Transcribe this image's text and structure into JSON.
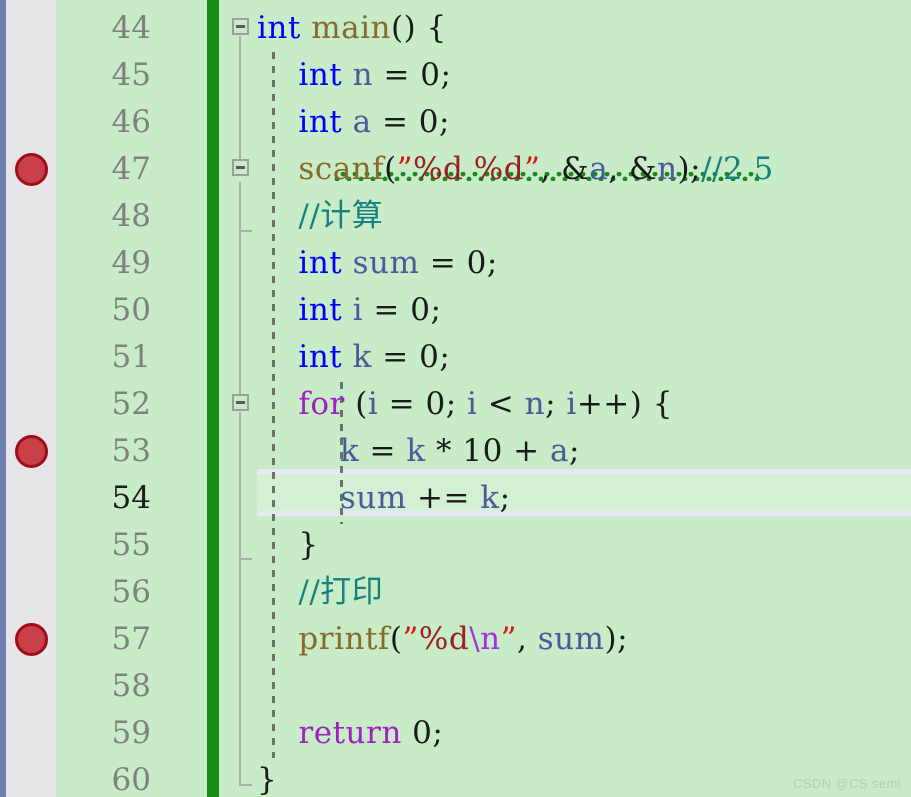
{
  "editor": {
    "language": "c",
    "background_color": "#c8ecc8",
    "gutter_color": "#e6e6e8",
    "change_bar_color": "#188a18",
    "edge_strip_color": "#6b7fae",
    "current_line": 54,
    "first_visible_line": 44,
    "last_visible_line": 60,
    "line_height": 47
  },
  "watermark": {
    "text": "CSDN @CS semi"
  },
  "breakpoints": [
    {
      "line": 47,
      "color": "#c8404a",
      "border_color": "#a00c18"
    },
    {
      "line": 53,
      "color": "#c8404a",
      "border_color": "#a00c18"
    },
    {
      "line": 57,
      "color": "#c8404a",
      "border_color": "#a00c18"
    }
  ],
  "line_numbers": [
    {
      "number": "44",
      "current": false
    },
    {
      "number": "45",
      "current": false
    },
    {
      "number": "46",
      "current": false
    },
    {
      "number": "47",
      "current": false
    },
    {
      "number": "48",
      "current": false
    },
    {
      "number": "49",
      "current": false
    },
    {
      "number": "50",
      "current": false
    },
    {
      "number": "51",
      "current": false
    },
    {
      "number": "52",
      "current": false
    },
    {
      "number": "53",
      "current": false
    },
    {
      "number": "54",
      "current": true
    },
    {
      "number": "55",
      "current": false
    },
    {
      "number": "56",
      "current": false
    },
    {
      "number": "57",
      "current": false
    },
    {
      "number": "58",
      "current": false
    },
    {
      "number": "59",
      "current": false
    },
    {
      "number": "60",
      "current": false
    }
  ],
  "fold_markers": [
    {
      "line": 44,
      "state": "expanded",
      "icon": "fold-minus-icon"
    },
    {
      "line": 47,
      "state": "expanded",
      "icon": "fold-minus-icon"
    },
    {
      "line": 52,
      "state": "expanded",
      "icon": "fold-minus-icon"
    }
  ],
  "code_lines": [
    {
      "line": 44,
      "text": "int main() {",
      "tokens": [
        {
          "t": "int",
          "c": "t-kw"
        },
        {
          "t": " ",
          "c": "t-plain"
        },
        {
          "t": "main",
          "c": "t-fn"
        },
        {
          "t": "() {",
          "c": "t-punct"
        }
      ]
    },
    {
      "line": 45,
      "text": "    int n = 0;",
      "tokens": [
        {
          "t": "    ",
          "c": "t-plain"
        },
        {
          "t": "int",
          "c": "t-kw"
        },
        {
          "t": " ",
          "c": "t-plain"
        },
        {
          "t": "n",
          "c": "t-var"
        },
        {
          "t": " = ",
          "c": "t-punct"
        },
        {
          "t": "0",
          "c": "t-num"
        },
        {
          "t": ";",
          "c": "t-punct"
        }
      ]
    },
    {
      "line": 46,
      "text": "    int a = 0;",
      "tokens": [
        {
          "t": "    ",
          "c": "t-plain"
        },
        {
          "t": "int",
          "c": "t-kw"
        },
        {
          "t": " ",
          "c": "t-plain"
        },
        {
          "t": "a",
          "c": "t-var"
        },
        {
          "t": " = ",
          "c": "t-punct"
        },
        {
          "t": "0",
          "c": "t-num"
        },
        {
          "t": ";",
          "c": "t-punct"
        }
      ]
    },
    {
      "line": 47,
      "text": "    scanf(\"%d %d\", &a, &n);//2 5",
      "has_error_squiggle": true,
      "tokens": [
        {
          "t": "    ",
          "c": "t-plain"
        },
        {
          "t": "scanf",
          "c": "t-fn"
        },
        {
          "t": "(",
          "c": "t-punct"
        },
        {
          "t": "”",
          "c": "t-quote"
        },
        {
          "t": "%d %d",
          "c": "t-str"
        },
        {
          "t": "”",
          "c": "t-quote"
        },
        {
          "t": ", ",
          "c": "t-punct"
        },
        {
          "t": "&",
          "c": "t-punct"
        },
        {
          "t": "a",
          "c": "t-var"
        },
        {
          "t": ", ",
          "c": "t-punct"
        },
        {
          "t": "&",
          "c": "t-punct"
        },
        {
          "t": "n",
          "c": "t-var"
        },
        {
          "t": ")",
          "c": "t-punct"
        },
        {
          "t": ";",
          "c": "t-punct"
        },
        {
          "t": "//2 5",
          "c": "t-comment"
        }
      ]
    },
    {
      "line": 48,
      "text": "    //计算",
      "tokens": [
        {
          "t": "    ",
          "c": "t-plain"
        },
        {
          "t": "//计算",
          "c": "t-comment"
        }
      ]
    },
    {
      "line": 49,
      "text": "    int sum = 0;",
      "tokens": [
        {
          "t": "    ",
          "c": "t-plain"
        },
        {
          "t": "int",
          "c": "t-kw"
        },
        {
          "t": " ",
          "c": "t-plain"
        },
        {
          "t": "sum",
          "c": "t-var"
        },
        {
          "t": " = ",
          "c": "t-punct"
        },
        {
          "t": "0",
          "c": "t-num"
        },
        {
          "t": ";",
          "c": "t-punct"
        }
      ]
    },
    {
      "line": 50,
      "text": "    int i = 0;",
      "tokens": [
        {
          "t": "    ",
          "c": "t-plain"
        },
        {
          "t": "int",
          "c": "t-kw"
        },
        {
          "t": " ",
          "c": "t-plain"
        },
        {
          "t": "i",
          "c": "t-var"
        },
        {
          "t": " = ",
          "c": "t-punct"
        },
        {
          "t": "0",
          "c": "t-num"
        },
        {
          "t": ";",
          "c": "t-punct"
        }
      ]
    },
    {
      "line": 51,
      "text": "    int k = 0;",
      "tokens": [
        {
          "t": "    ",
          "c": "t-plain"
        },
        {
          "t": "int",
          "c": "t-kw"
        },
        {
          "t": " ",
          "c": "t-plain"
        },
        {
          "t": "k",
          "c": "t-var"
        },
        {
          "t": " = ",
          "c": "t-punct"
        },
        {
          "t": "0",
          "c": "t-num"
        },
        {
          "t": ";",
          "c": "t-punct"
        }
      ]
    },
    {
      "line": 52,
      "text": "    for (i = 0; i < n; i++) {",
      "tokens": [
        {
          "t": "    ",
          "c": "t-plain"
        },
        {
          "t": "for",
          "c": "t-ctrl"
        },
        {
          "t": " (",
          "c": "t-punct"
        },
        {
          "t": "i",
          "c": "t-var"
        },
        {
          "t": " = ",
          "c": "t-punct"
        },
        {
          "t": "0",
          "c": "t-num"
        },
        {
          "t": "; ",
          "c": "t-punct"
        },
        {
          "t": "i",
          "c": "t-var"
        },
        {
          "t": " < ",
          "c": "t-punct"
        },
        {
          "t": "n",
          "c": "t-var"
        },
        {
          "t": "; ",
          "c": "t-punct"
        },
        {
          "t": "i",
          "c": "t-var"
        },
        {
          "t": "++) {",
          "c": "t-punct"
        }
      ]
    },
    {
      "line": 53,
      "text": "        k = k * 10 + a;",
      "tokens": [
        {
          "t": "        ",
          "c": "t-plain"
        },
        {
          "t": "k",
          "c": "t-var"
        },
        {
          "t": " = ",
          "c": "t-punct"
        },
        {
          "t": "k",
          "c": "t-var"
        },
        {
          "t": " * ",
          "c": "t-punct"
        },
        {
          "t": "10",
          "c": "t-num"
        },
        {
          "t": " + ",
          "c": "t-punct"
        },
        {
          "t": "a",
          "c": "t-var"
        },
        {
          "t": ";",
          "c": "t-punct"
        }
      ]
    },
    {
      "line": 54,
      "text": "        sum += k;",
      "current": true,
      "tokens": [
        {
          "t": "        ",
          "c": "t-plain"
        },
        {
          "t": "sum",
          "c": "t-var"
        },
        {
          "t": " += ",
          "c": "t-punct"
        },
        {
          "t": "k",
          "c": "t-var"
        },
        {
          "t": ";",
          "c": "t-punct"
        }
      ]
    },
    {
      "line": 55,
      "text": "    }",
      "tokens": [
        {
          "t": "    ",
          "c": "t-plain"
        },
        {
          "t": "}",
          "c": "t-punct"
        }
      ]
    },
    {
      "line": 56,
      "text": "    //打印",
      "tokens": [
        {
          "t": "    ",
          "c": "t-plain"
        },
        {
          "t": "//打印",
          "c": "t-comment"
        }
      ]
    },
    {
      "line": 57,
      "text": "    printf(\"%d\\n\", sum);",
      "tokens": [
        {
          "t": "    ",
          "c": "t-plain"
        },
        {
          "t": "printf",
          "c": "t-fn"
        },
        {
          "t": "(",
          "c": "t-punct"
        },
        {
          "t": "”",
          "c": "t-quote"
        },
        {
          "t": "%d",
          "c": "t-str"
        },
        {
          "t": "\\n",
          "c": "t-esc"
        },
        {
          "t": "”",
          "c": "t-quote"
        },
        {
          "t": ", ",
          "c": "t-punct"
        },
        {
          "t": "sum",
          "c": "t-var"
        },
        {
          "t": ")",
          "c": "t-punct"
        },
        {
          "t": ";",
          "c": "t-punct"
        }
      ]
    },
    {
      "line": 58,
      "text": "",
      "tokens": []
    },
    {
      "line": 59,
      "text": "    return 0;",
      "tokens": [
        {
          "t": "    ",
          "c": "t-plain"
        },
        {
          "t": "return",
          "c": "t-ctrl"
        },
        {
          "t": " ",
          "c": "t-plain"
        },
        {
          "t": "0",
          "c": "t-num"
        },
        {
          "t": ";",
          "c": "t-punct"
        }
      ]
    },
    {
      "line": 60,
      "text": "}",
      "tokens": [
        {
          "t": "}",
          "c": "t-punct"
        }
      ]
    }
  ]
}
